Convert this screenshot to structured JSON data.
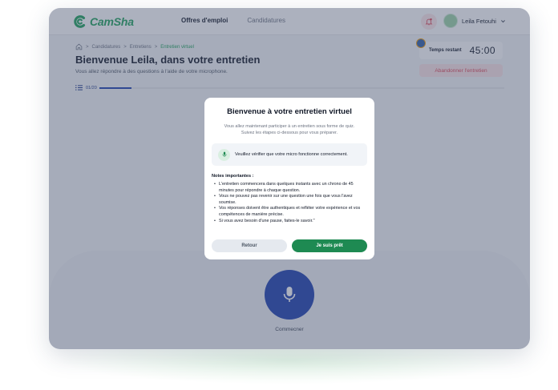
{
  "app": {
    "logo_text": "CamSha",
    "brand_color": "#1ea35b",
    "accent_color": "#1e40af"
  },
  "nav": {
    "items": [
      {
        "label": "Offres d'emploi",
        "active": true
      },
      {
        "label": "Candidatures",
        "active": false
      }
    ]
  },
  "user": {
    "name": "Leila Fetouhi",
    "notifications_icon": "bell-icon"
  },
  "breadcrumb": {
    "home_icon": "home-icon",
    "items": [
      "Candidatures",
      "Entretiens",
      "Entretien virtuel"
    ],
    "separator": ">"
  },
  "page": {
    "title": "Bienvenue Leila, dans votre entretien",
    "subtitle": "Vous allez répondre à des questions à l'aide de votre microphone.",
    "progress_label": "01/20",
    "progress_fraction": 0.08
  },
  "timer": {
    "label": "Temps restant",
    "value": "45:00"
  },
  "actions": {
    "abandon_label": "Abandonner l'entretien",
    "start_label": "Commecner"
  },
  "modal": {
    "title": "Bienvenue à votre entretien virtuel",
    "subtitle": "Vous allez maintenant participer à un entretien sous forme de quiz. Suivez les étapes ci-dessous pour vous préparer.",
    "mic_check": "Veuillez vérifier que votre micro fonctionne correctement.",
    "notes_title": "Notes importantes :",
    "notes": [
      "L'entretien commencera dans quelques instants avec un chrono de 45 minutes pour répondre à chaque question.",
      "Vous ne pouvez pas revenir sur une question une fois que vous l'avez soumise.",
      "Vos réponses doivent être authentiques et refléter votre expérience et vos compétences de manière précise.",
      "Si vous avez besoin d'une pause, faites-le savoir.\""
    ],
    "back_label": "Retour",
    "ready_label": "Je suis prêt"
  }
}
